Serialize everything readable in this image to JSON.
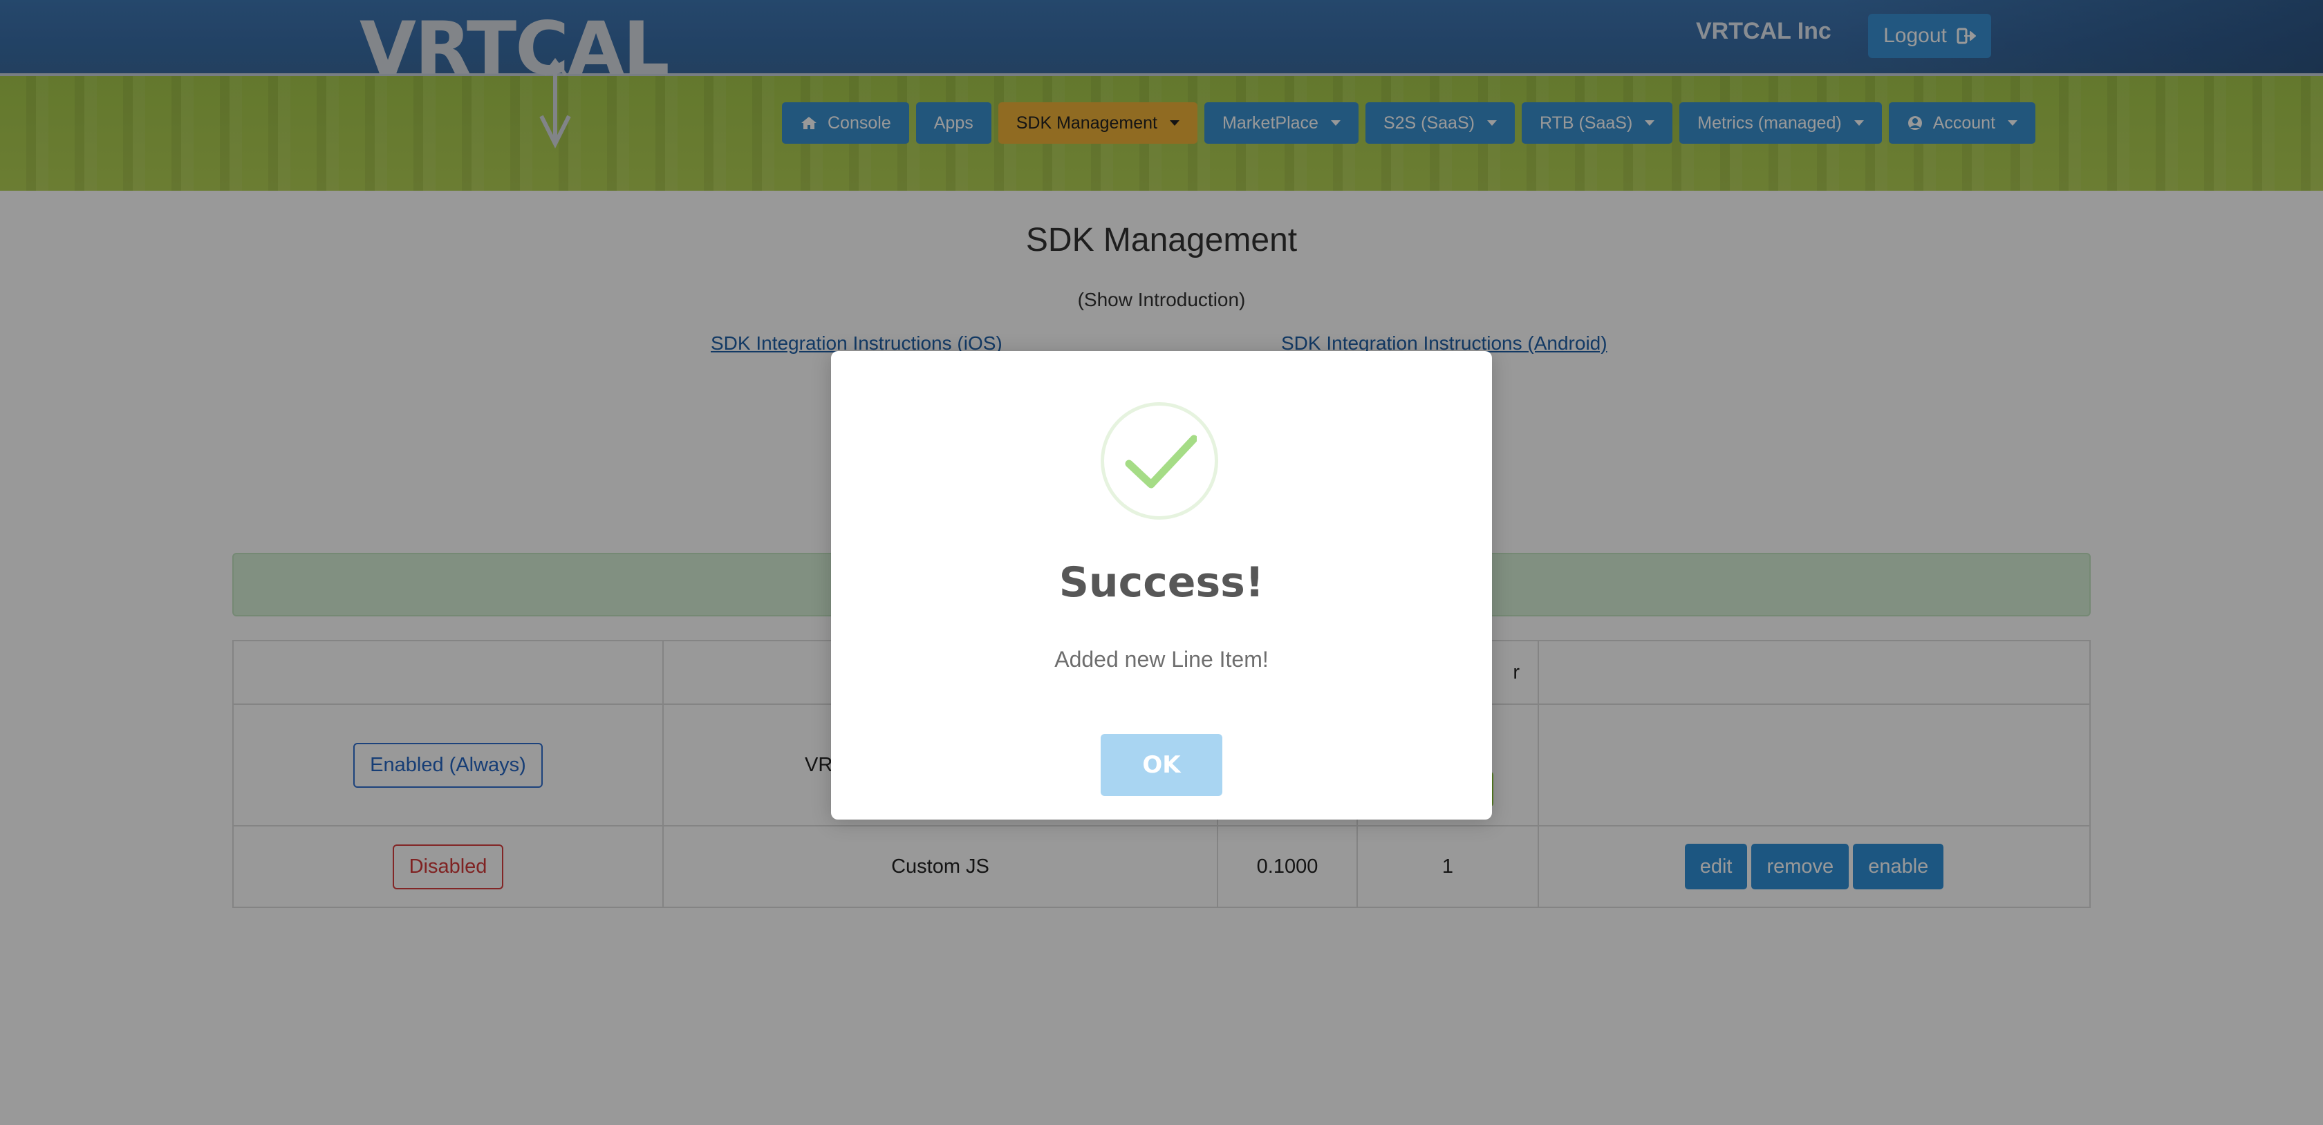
{
  "header": {
    "logo_text": "VRTCAL",
    "company": "VRTCAL Inc",
    "logout_label": "Logout"
  },
  "nav": {
    "items": [
      {
        "label": "Console",
        "icon": "home-icon",
        "active": false,
        "dropdown": false
      },
      {
        "label": "Apps",
        "active": false,
        "dropdown": false
      },
      {
        "label": "SDK Management",
        "active": true,
        "dropdown": true
      },
      {
        "label": "MarketPlace",
        "active": false,
        "dropdown": true
      },
      {
        "label": "S2S (SaaS)",
        "active": false,
        "dropdown": true
      },
      {
        "label": "RTB (SaaS)",
        "active": false,
        "dropdown": true
      },
      {
        "label": "Metrics (managed)",
        "active": false,
        "dropdown": true
      },
      {
        "label": "Account",
        "icon": "user-circle-icon",
        "active": false,
        "dropdown": true
      }
    ]
  },
  "page": {
    "title": "SDK Management",
    "show_intro": "(Show Introduction)",
    "link_ios": "SDK Integration Instructions (iOS)",
    "link_android": "SDK Integration Instructions (Android)"
  },
  "table": {
    "header_partial": "r",
    "rows": [
      {
        "status": "Enabled (Always)",
        "name_partial": "VR",
        "price": "",
        "priority": "",
        "actions": []
      },
      {
        "status": "Disabled",
        "name": "Custom JS",
        "price": "0.1000",
        "priority": "1",
        "actions": [
          "edit",
          "remove",
          "enable"
        ]
      }
    ]
  },
  "modal": {
    "title": "Success!",
    "message": "Added new Line Item!",
    "ok_label": "OK"
  },
  "colors": {
    "header_blue": "#3a6ea8",
    "green_band": "#aacb4f",
    "nav_blue": "#3a8fcf",
    "nav_active": "#f0b33a",
    "ok_button": "#a9d5f2",
    "check_green": "#a5dc86"
  }
}
